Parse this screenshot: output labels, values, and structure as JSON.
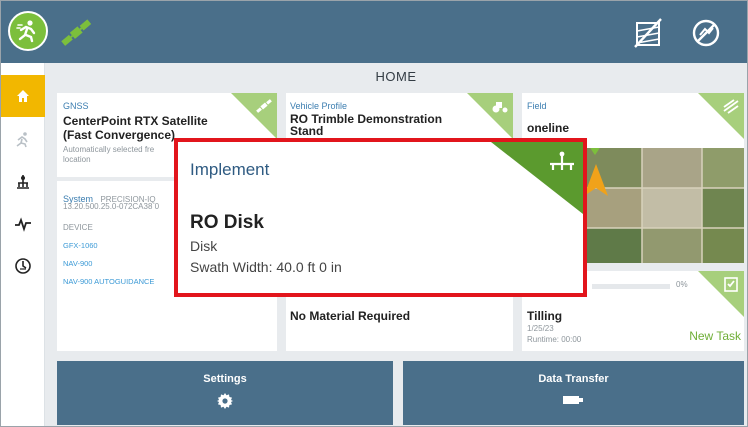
{
  "header": {
    "title": "HOME"
  },
  "cards": {
    "gnss": {
      "label": "GNSS",
      "value_line1": "CenterPoint RTX Satellite",
      "value_line2": "(Fast Convergence)",
      "note_line1": "Automatically selected fre",
      "note_line2": "location"
    },
    "system": {
      "label": "System",
      "model": "PRECISION-IQ",
      "version": "13.20.500.25.0-072CA38 0",
      "device_label": "DEVICE",
      "devices": [
        "GFX-1060",
        "NAV-900",
        "NAV-900 AUTOGUIDANCE"
      ]
    },
    "vehicle": {
      "label": "Vehicle Profile",
      "value_line1": "RO Trimble Demonstration",
      "value_line2": "Stand"
    },
    "field": {
      "label": "Field",
      "value": "oneline"
    },
    "material": {
      "value": "No Material Required"
    },
    "task": {
      "progress_text": "0%",
      "progress_value": 0,
      "value": "Tilling",
      "date": "1/25/23",
      "runtime": "Runtime: 00:00",
      "new_task_label": "New Task"
    }
  },
  "implement": {
    "label": "Implement",
    "name": "RO Disk",
    "type": "Disk",
    "swath": "Swath Width: 40.0 ft 0 in"
  },
  "buttons": {
    "settings": "Settings",
    "data_transfer": "Data Transfer"
  },
  "colors": {
    "topbar": "#4a6f8a",
    "accent_green": "#7cbf3c",
    "home_highlight": "#f2b700",
    "card_corner": "#a7cf7c",
    "implement_corner": "#5b9a2e",
    "highlight_border": "#e2151c"
  },
  "icons": {
    "logo": "runner-logo-icon",
    "satellite": "satellite-icon",
    "no_field": "no-field-icon",
    "no_guidance": "no-guidance-icon",
    "home": "home-icon",
    "guidance": "guidance-runner-icon",
    "implement_nav": "implement-icon",
    "activity": "activity-icon",
    "rate": "rate-icon",
    "settings": "gear-icon",
    "data_transfer": "usb-drive-icon"
  }
}
